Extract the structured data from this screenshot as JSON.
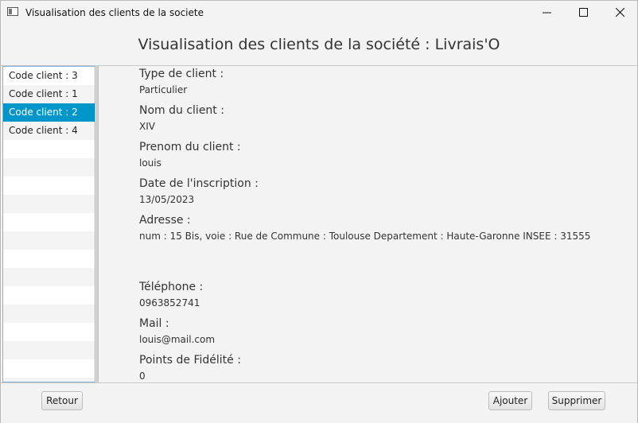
{
  "window": {
    "title": "Visualisation des clients de la societe"
  },
  "header": {
    "title": "Visualisation des clients de la société : Livrais'O"
  },
  "client_list": {
    "items": [
      {
        "label": "Code client : 3"
      },
      {
        "label": "Code client : 1"
      },
      {
        "label": "Code client : 2",
        "selected": true
      },
      {
        "label": "Code client : 4"
      }
    ]
  },
  "details": {
    "type_label": "Type de client :",
    "type_value": "Particulier",
    "nom_label": "Nom du client :",
    "nom_value": "XIV",
    "prenom_label": "Prenom du client :",
    "prenom_value": "louis",
    "date_label": "Date de l'inscription :",
    "date_value": "13/05/2023",
    "adresse_label": "Adresse :",
    "adresse_value": "num : 15 Bis, voie : Rue de  Commune : Toulouse Departement : Haute-Garonne INSEE : 31555",
    "telephone_label": "Téléphone :",
    "telephone_value": "0963852741",
    "mail_label": "Mail :",
    "mail_value": "louis@mail.com",
    "points_label": "Points de Fidélité :",
    "points_value": "0"
  },
  "footer": {
    "retour_label": "Retour",
    "ajouter_label": "Ajouter",
    "supprimer_label": "Supprimer"
  },
  "colors": {
    "selection": "#0096c9",
    "list_border": "#7fb5d8"
  }
}
